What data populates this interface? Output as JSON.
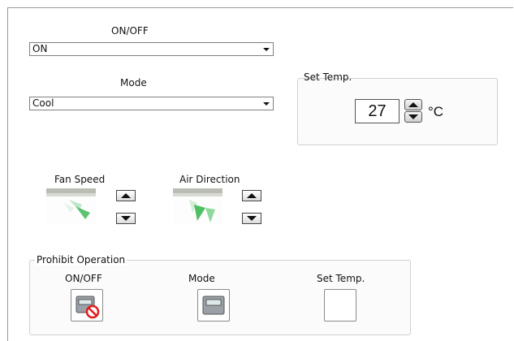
{
  "power": {
    "label": "ON/OFF",
    "selected": "ON"
  },
  "mode": {
    "label": "Mode",
    "selected": "Cool"
  },
  "set_temp": {
    "title": "Set Temp.",
    "value": "27",
    "unit": "°C"
  },
  "fan_speed": {
    "label": "Fan Speed"
  },
  "air_direction": {
    "label": "Air Direction"
  },
  "prohibit": {
    "title": "Prohibit Operation",
    "on_off_label": "ON/OFF",
    "mode_label": "Mode",
    "set_temp_label": "Set Temp."
  },
  "colors": {
    "accent_green": "#2fa84f",
    "prohibit_red": "#e21b1b"
  }
}
